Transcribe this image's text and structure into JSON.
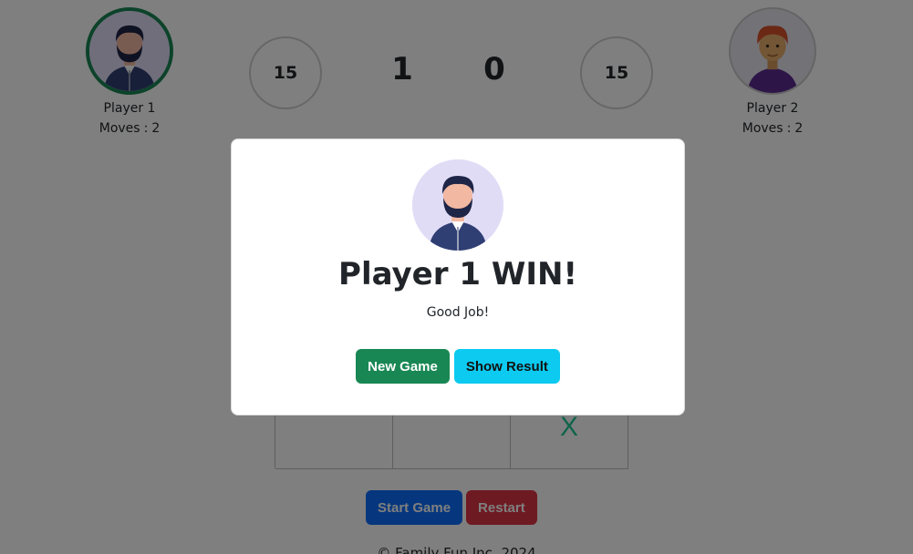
{
  "players": [
    {
      "name": "Player 1",
      "moves_label": "Moves",
      "moves": "2",
      "avatar": "bearded-man-avatar-icon",
      "active": true
    },
    {
      "name": "Player 2",
      "moves_label": "Moves",
      "moves": "2",
      "avatar": "redhead-avatar-icon",
      "active": false
    }
  ],
  "timers": [
    "15",
    "15"
  ],
  "scores": [
    "1",
    "0"
  ],
  "board": {
    "cells": [
      "",
      "",
      "",
      "",
      "",
      "",
      "",
      "",
      "X"
    ]
  },
  "controls": {
    "start_label": "Start Game",
    "restart_label": "Restart"
  },
  "footer": "© Family Fun Inc. 2024",
  "modal": {
    "title": "Player 1 WIN!",
    "subtitle": "Good Job!",
    "new_game_label": "New Game",
    "show_result_label": "Show Result"
  },
  "colors": {
    "success": "#198754",
    "info": "#0dcaf0",
    "primary": "#0d6efd",
    "danger": "#dc3545",
    "mark_x": "#20c997"
  }
}
